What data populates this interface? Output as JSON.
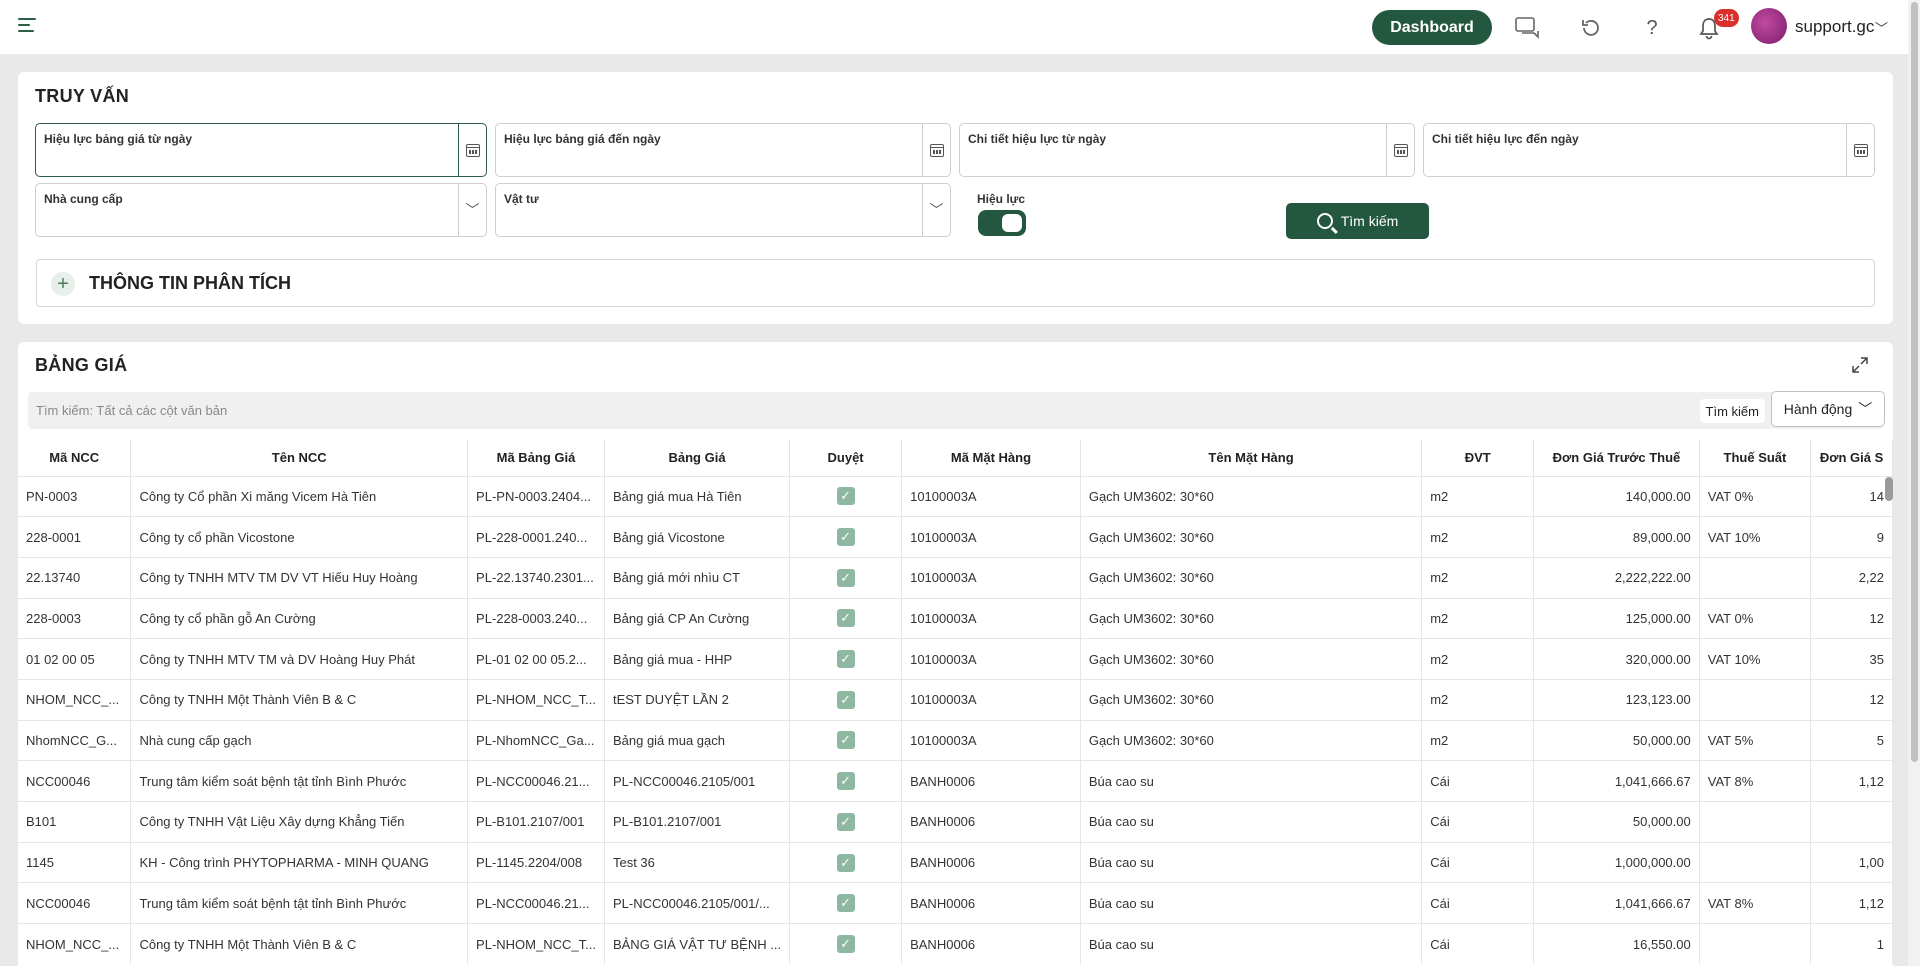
{
  "topbar": {
    "dashboard_label": "Dashboard",
    "notification_count": "341",
    "username": "support.gc",
    "icons": [
      "menu-icon",
      "chat-icon",
      "refresh-icon",
      "help-icon",
      "bell-icon",
      "avatar"
    ]
  },
  "query": {
    "title": "TRUY VẤN",
    "fields": {
      "valid_from": "Hiệu lực bảng giá từ ngày",
      "valid_to": "Hiệu lực bảng giá đến ngày",
      "detail_from": "Chi tiết hiệu lực từ ngày",
      "detail_to": "Chi tiết hiệu lực đến ngày",
      "supplier": "Nhà cung cấp",
      "material": "Vật tư",
      "active": "Hiệu lực"
    },
    "search_label": "Tìm kiếm",
    "analysis_title": "THÔNG TIN PHÂN TÍCH"
  },
  "price_table": {
    "title": "BẢNG GIÁ",
    "search_placeholder": "Tìm kiếm: Tất cả các cột văn bản",
    "search_button": "Tìm kiếm",
    "action_button": "Hành động",
    "columns": [
      "Mã NCC",
      "Tên NCC",
      "Mã Bảng Giá",
      "Bảng Giá",
      "Duyệt",
      "Mã Mặt Hàng",
      "Tên Mặt Hàng",
      "ĐVT",
      "Đơn Giá Trước Thuế",
      "Thuế Suất",
      "Đơn Giá S"
    ],
    "rows": [
      [
        "PN-0003",
        "Công ty Cổ phần Xi măng Vicem Hà Tiên",
        "PL-PN-0003.2404...",
        "Bảng giá mua Hà Tiên",
        "✓",
        "10100003A",
        "Gạch UM3602: 30*60",
        "m2",
        "140,000.00",
        "VAT 0%",
        "14"
      ],
      [
        "228-0001",
        "Công ty cổ phần Vicostone",
        "PL-228-0001.240...",
        "Bảng giá Vicostone",
        "✓",
        "10100003A",
        "Gạch UM3602: 30*60",
        "m2",
        "89,000.00",
        "VAT 10%",
        "9"
      ],
      [
        "22.13740",
        "Công ty TNHH MTV TM DV VT Hiếu Huy Hoàng",
        "PL-22.13740.2301...",
        "Bảng giá mới nhìu CT",
        "✓",
        "10100003A",
        "Gạch UM3602: 30*60",
        "m2",
        "2,222,222.00",
        "",
        "2,22"
      ],
      [
        "228-0003",
        "Công ty cổ phần gỗ An Cường",
        "PL-228-0003.240...",
        "Bảng giá CP An Cường",
        "✓",
        "10100003A",
        "Gạch UM3602: 30*60",
        "m2",
        "125,000.00",
        "VAT 0%",
        "12"
      ],
      [
        "01 02 00 05",
        "Công ty TNHH MTV TM và DV Hoàng Huy Phát",
        "PL-01 02 00 05.2...",
        "Bảng giá mua - HHP",
        "✓",
        "10100003A",
        "Gạch UM3602: 30*60",
        "m2",
        "320,000.00",
        "VAT 10%",
        "35"
      ],
      [
        "NHOM_NCC_...",
        "Công ty TNHH Một Thành Viên B & C",
        "PL-NHOM_NCC_T...",
        "tEST DUYỆT LẦN 2",
        "✓",
        "10100003A",
        "Gạch UM3602: 30*60",
        "m2",
        "123,123.00",
        "",
        "12"
      ],
      [
        "NhomNCC_G...",
        "Nhà cung cấp gạch",
        "PL-NhomNCC_Ga...",
        "Bảng giá mua gạch",
        "✓",
        "10100003A",
        "Gạch UM3602: 30*60",
        "m2",
        "50,000.00",
        "VAT 5%",
        "5"
      ],
      [
        "NCC00046",
        "Trung tâm kiểm soát bệnh tật tỉnh Bình Phước",
        "PL-NCC00046.21...",
        "PL-NCC00046.2105/001",
        "✓",
        "BANH0006",
        "Búa cao su",
        "Cái",
        "1,041,666.67",
        "VAT 8%",
        "1,12"
      ],
      [
        "B101",
        "Công ty TNHH Vật Liệu Xây dựng Khẳng Tiến",
        "PL-B101.2107/001",
        "PL-B101.2107/001",
        "✓",
        "BANH0006",
        "Búa cao su",
        "Cái",
        "50,000.00",
        "",
        ""
      ],
      [
        "1145",
        "KH - Công trình PHYTOPHARMA - MINH QUANG",
        "PL-1145.2204/008",
        "Test 36",
        "✓",
        "BANH0006",
        "Búa cao su",
        "Cái",
        "1,000,000.00",
        "",
        "1,00"
      ],
      [
        "NCC00046",
        "Trung tâm kiểm soát bệnh tật tỉnh Bình Phước",
        "PL-NCC00046.21...",
        "PL-NCC00046.2105/001/...",
        "✓",
        "BANH0006",
        "Búa cao su",
        "Cái",
        "1,041,666.67",
        "VAT 8%",
        "1,12"
      ],
      [
        "NHOM_NCC_...",
        "Công ty TNHH Một Thành Viên B & C",
        "PL-NHOM_NCC_T...",
        "BẢNG GIÁ VẬT TƯ BỆNH ...",
        "✓",
        "BANH0006",
        "Búa cao su",
        "Cái",
        "16,550.00",
        "",
        "1"
      ]
    ]
  }
}
